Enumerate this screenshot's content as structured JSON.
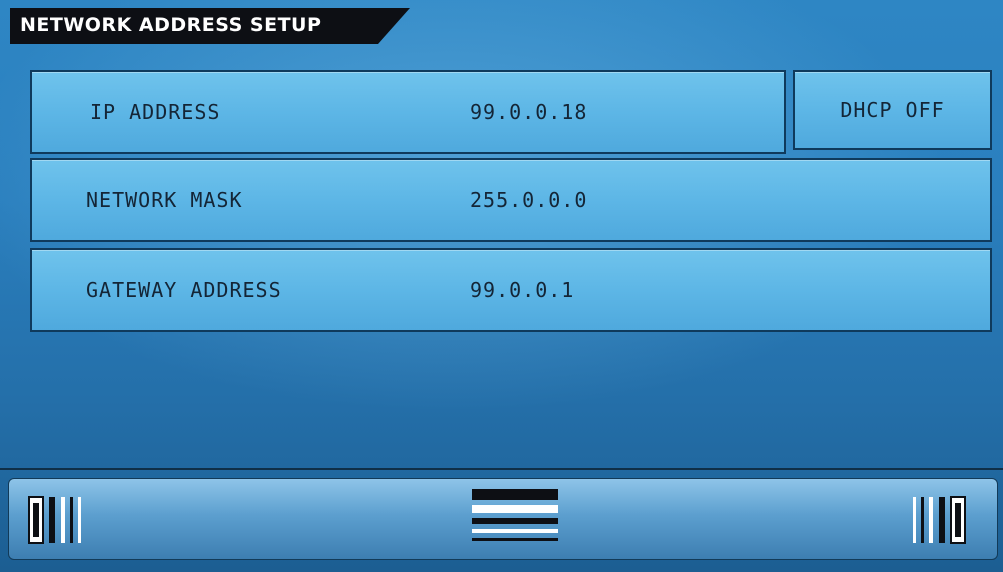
{
  "header": {
    "title": "NETWORK ADDRESS SETUP"
  },
  "fields": [
    {
      "label": "IP ADDRESS",
      "value": "99.0.0.18"
    },
    {
      "label": "NETWORK MASK",
      "value": "255.0.0.0"
    },
    {
      "label": "GATEWAY ADDRESS",
      "value": "99.0.0.1"
    }
  ],
  "dhcp_button": {
    "label": "DHCP OFF"
  },
  "bottom_bar": {
    "prev_icon": "page-previous-icon",
    "menu_icon": "menu-icon",
    "next_icon": "page-next-icon"
  },
  "colors": {
    "background": "#2a7fbe",
    "field_fill": "#5db6e6",
    "text": "#142536",
    "header_tab": "#0d0f14"
  }
}
